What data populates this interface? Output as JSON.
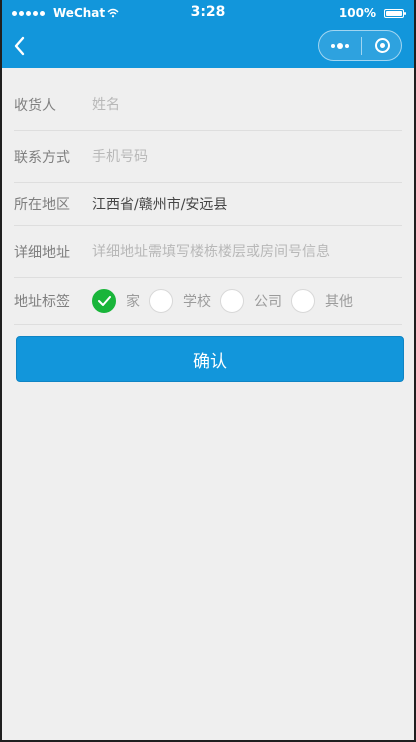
{
  "status_bar": {
    "carrier": "WeChat",
    "time": "3:28",
    "battery": "100%"
  },
  "form": {
    "recipient": {
      "label": "收货人",
      "placeholder": "姓名"
    },
    "contact": {
      "label": "联系方式",
      "placeholder": "手机号码"
    },
    "region": {
      "label": "所在地区",
      "value": "江西省/赣州市/安远县"
    },
    "detail": {
      "label": "详细地址",
      "placeholder": "详细地址需填写楼栋楼层或房间号信息"
    },
    "tag": {
      "label": "地址标签",
      "options": [
        {
          "label": "家",
          "selected": true
        },
        {
          "label": "学校",
          "selected": false
        },
        {
          "label": "公司",
          "selected": false
        },
        {
          "label": "其他",
          "selected": false
        }
      ]
    }
  },
  "actions": {
    "confirm": "确认"
  },
  "icons": {
    "back": "chevron-left-icon",
    "more": "more-dots-icon",
    "close": "target-circle-icon",
    "check": "check-icon",
    "wifi": "wifi-icon",
    "battery": "battery-icon"
  },
  "colors": {
    "header": "#1296db",
    "background": "#efefef",
    "selected": "#19b53a"
  }
}
